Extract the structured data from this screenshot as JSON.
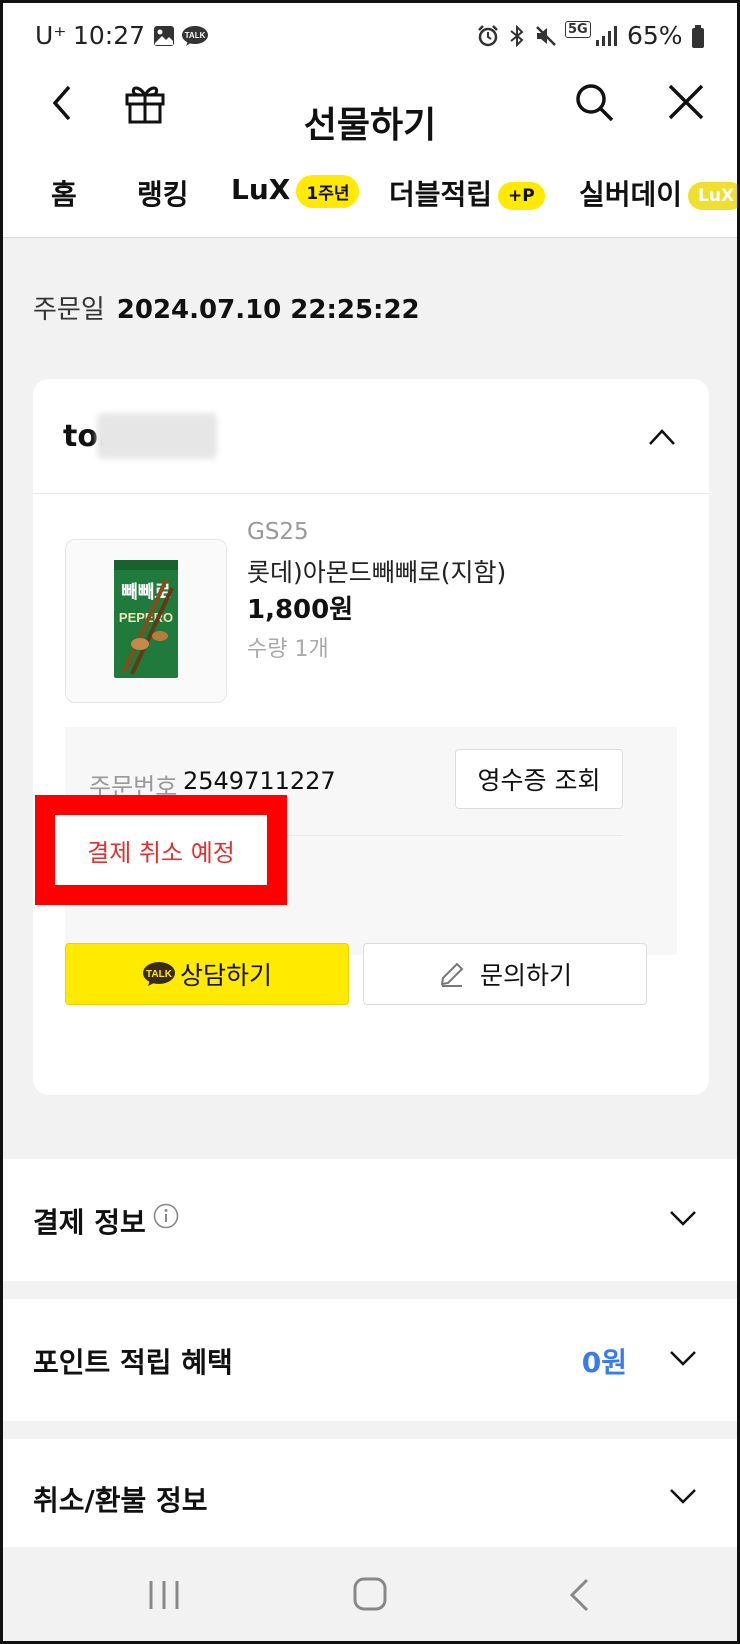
{
  "status_bar": {
    "carrier": "U⁺",
    "time": "10:27",
    "network": "5G",
    "battery": "65%"
  },
  "header": {
    "title": "선물하기"
  },
  "tabs": [
    {
      "label": "홈",
      "badge": ""
    },
    {
      "label": "랭킹",
      "badge": ""
    },
    {
      "label": "LuX",
      "badge": "1주년"
    },
    {
      "label": "더블적립",
      "badge": "+P"
    },
    {
      "label": "실버데이",
      "badge": "LuX"
    }
  ],
  "order": {
    "date_label": "주문일",
    "date_value": "2024.07.10 22:25:22"
  },
  "card": {
    "recipient_prefix": "to.",
    "product": {
      "store": "GS25",
      "name": "롯데)아몬드빼빼로(지함)",
      "price": "1,800원",
      "quantity": "수량 1개"
    },
    "order_number_label": "주문번호",
    "order_number": "2549711227",
    "receipt_button": "영수증 조회",
    "status_text": "결제 취소 예정",
    "talk_badge": "TALK",
    "chat_button": "상담하기",
    "inquiry_button": "문의하기"
  },
  "sections": {
    "payment_info": "결제 정보",
    "points": "포인트 적립 혜택",
    "points_value": "0원",
    "refund_info": "취소/환불 정보"
  },
  "colors": {
    "accent_yellow": "#ffea00",
    "status_red": "#e03131",
    "highlight_red": "#ff0000",
    "points_blue": "#3a7af0"
  }
}
